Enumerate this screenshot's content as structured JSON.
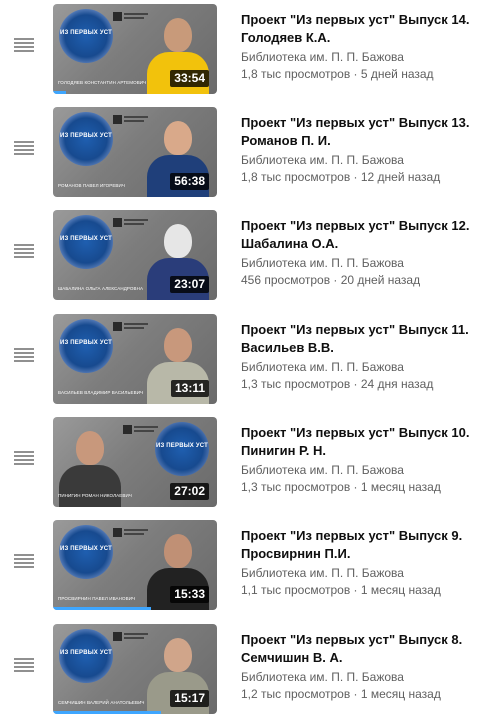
{
  "playlist": {
    "items": [
      {
        "title": "Проект \"Из первых уст\" Выпуск 14. Голодяев К.А.",
        "channel": "Библиотека им. П. П. Бажова",
        "views": "1,8 тыс просмотров",
        "age": "5 дней назад",
        "stats": "1,8 тыс просмотров · 5 дней назад",
        "duration": "33:54",
        "logo_text": "ИЗ ПЕРВЫХ УСТ",
        "thumb_caption": "ГОЛОДЯЕВ КОНСТАНТИН АРТЕМОВИЧ",
        "watched": 0.08,
        "person_side": "right",
        "shirt_color": "#f2c20c",
        "head_color": "#c89a7a"
      },
      {
        "title": "Проект \"Из первых уст\" Выпуск 13. Романов П. И.",
        "channel": "Библиотека им. П. П. Бажова",
        "views": "1,8 тыс просмотров",
        "age": "12 дней назад",
        "stats": "1,8 тыс просмотров · 12 дней назад",
        "duration": "56:38",
        "logo_text": "ИЗ ПЕРВЫХ УСТ",
        "thumb_caption": "РОМАНОВ ПАВЕЛ ИГОРЕВИЧ",
        "watched": 0.0,
        "person_side": "right",
        "shirt_color": "#1f3f7a",
        "head_color": "#d9a98a"
      },
      {
        "title": "Проект \"Из первых уст\" Выпуск 12. Шабалина О.А.",
        "channel": "Библиотека им. П. П. Бажова",
        "views": "456 просмотров",
        "age": "20 дней назад",
        "stats": "456 просмотров · 20 дней назад",
        "duration": "23:07",
        "logo_text": "ИЗ ПЕРВЫХ УСТ",
        "thumb_caption": "ШАБАЛИНА ОЛЬГА АЛЕКСАНДРОВНА",
        "watched": 0.0,
        "person_side": "right",
        "shirt_color": "#2a3d7a",
        "head_color": "#e6e6e6"
      },
      {
        "title": "Проект \"Из первых уст\" Выпуск 11. Васильев В.В.",
        "channel": "Библиотека им. П. П. Бажова",
        "views": "1,3 тыс просмотров",
        "age": "24 дня назад",
        "stats": "1,3 тыс просмотров · 24 дня назад",
        "duration": "13:11",
        "logo_text": "ИЗ ПЕРВЫХ УСТ",
        "thumb_caption": "ВАСИЛЬЕВ ВЛАДИМИР ВАСИЛЬЕВИЧ",
        "watched": 0.0,
        "person_side": "right",
        "shirt_color": "#b8b8a8",
        "head_color": "#c8987c"
      },
      {
        "title": "Проект \"Из первых уст\" Выпуск 10. Пинигин Р. Н.",
        "channel": "Библиотека им. П. П. Бажова",
        "views": "1,3 тыс просмотров",
        "age": "1 месяц назад",
        "stats": "1,3 тыс просмотров · 1 месяц назад",
        "duration": "27:02",
        "logo_text": "ИЗ ПЕРВЫХ УСТ",
        "thumb_caption": "ПИНИГИН РОМАН НИКОЛАЕВИЧ",
        "watched": 0.0,
        "person_side": "left",
        "shirt_color": "#3a3a3a",
        "head_color": "#c8987c"
      },
      {
        "title": "Проект \"Из первых уст\" Выпуск 9. Просвирнин П.И.",
        "channel": "Библиотека им. П. П. Бажова",
        "views": "1,1 тыс просмотров",
        "age": "1 месяц назад",
        "stats": "1,1 тыс просмотров · 1 месяц назад",
        "duration": "15:33",
        "logo_text": "ИЗ ПЕРВЫХ УСТ",
        "thumb_caption": "ПРОСВИРНИН ПАВЕЛ ИВАНОВИЧ",
        "watched": 0.6,
        "person_side": "right",
        "shirt_color": "#222222",
        "head_color": "#c09075"
      },
      {
        "title": "Проект \"Из первых уст\" Выпуск 8. Семчишин В. А.",
        "channel": "Библиотека им. П. П. Бажова",
        "views": "1,2 тыс просмотров",
        "age": "1 месяц назад",
        "stats": "1,2 тыс просмотров · 1 месяц назад",
        "duration": "15:17",
        "logo_text": "ИЗ ПЕРВЫХ УСТ",
        "thumb_caption": "СЕМЧИШИН ВАЛЕРИЙ АНАТОЛЬЕВИЧ",
        "watched": 0.66,
        "person_side": "right",
        "shirt_color": "#9a9a8a",
        "head_color": "#d0a58a"
      }
    ]
  },
  "colors": {
    "accent_progress": "#3ea6ff",
    "logo_blue": "#1f5fb0",
    "text_primary": "#0f0f0f",
    "text_secondary": "#606060"
  }
}
